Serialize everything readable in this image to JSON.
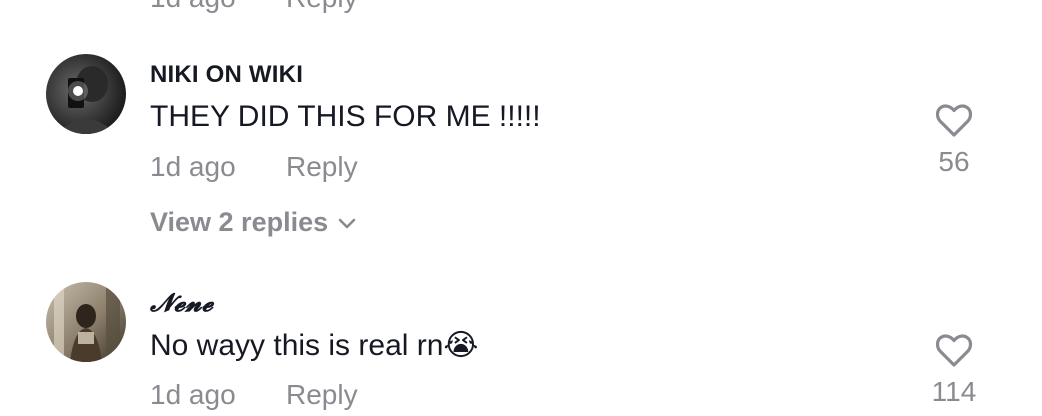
{
  "previous_comment": {
    "time": "1d ago",
    "reply_label": "Reply"
  },
  "comments": [
    {
      "username": "NIKI ON WIKI",
      "text": "THEY DID THIS FOR ME !!!!!",
      "time": "1d ago",
      "reply_label": "Reply",
      "likes": "56",
      "view_replies": "View 2 replies"
    },
    {
      "username": "𝓝𝓮𝓷𝓮",
      "text": "No wayy this is real rn😭",
      "time": "1d ago",
      "reply_label": "Reply",
      "likes": "114"
    }
  ],
  "icons": {
    "like": "heart-outline-icon",
    "expand": "chevron-down-icon"
  },
  "colors": {
    "primary_text": "#161823",
    "secondary_text": "#8a8b91",
    "background": "#ffffff"
  }
}
